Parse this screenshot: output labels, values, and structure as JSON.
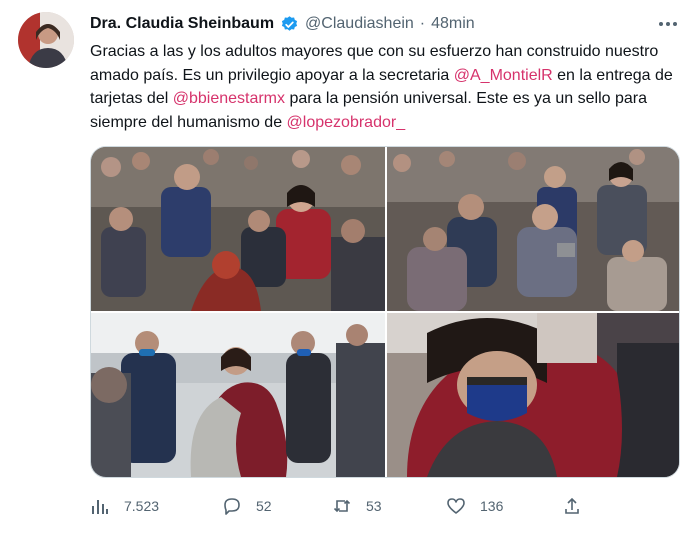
{
  "author": {
    "display_name": "Dra. Claudia Sheinbaum",
    "handle": "@Claudiashein",
    "separator": "·",
    "time": "48min",
    "verified": true,
    "avatar_icon": "profile-photo"
  },
  "tweet": {
    "segments": [
      {
        "text": "Gracias a las y los adultos mayores que con su esfuerzo han construido nuestro amado país. Es un privilegio apoyar a la secretaria ",
        "mention": false
      },
      {
        "text": "@A_MontielR",
        "mention": true
      },
      {
        "text": " en la entrega de tarjetas del ",
        "mention": false
      },
      {
        "text": "@bbienestarmx",
        "mention": true
      },
      {
        "text": " para la pensión universal. Este es ya un sello para siempre del humanismo de ",
        "mention": false
      },
      {
        "text": "@lopezobrador_",
        "mention": true
      }
    ]
  },
  "media": {
    "photos": [
      "crowd-greeting-photo",
      "crowd-selfie-photo",
      "hug-photo",
      "closeup-hug-photo"
    ]
  },
  "metrics": {
    "views": "7.523",
    "replies": "52",
    "retweets": "53",
    "likes": "136"
  },
  "colors": {
    "mention": "#d6336c",
    "secondary_text": "#536471",
    "verified": "#1d9bf0"
  },
  "icons": {
    "views": "bar-chart-icon",
    "reply": "comment-icon",
    "retweet": "retweet-icon",
    "like": "heart-icon",
    "share": "share-icon",
    "more": "more-icon"
  }
}
